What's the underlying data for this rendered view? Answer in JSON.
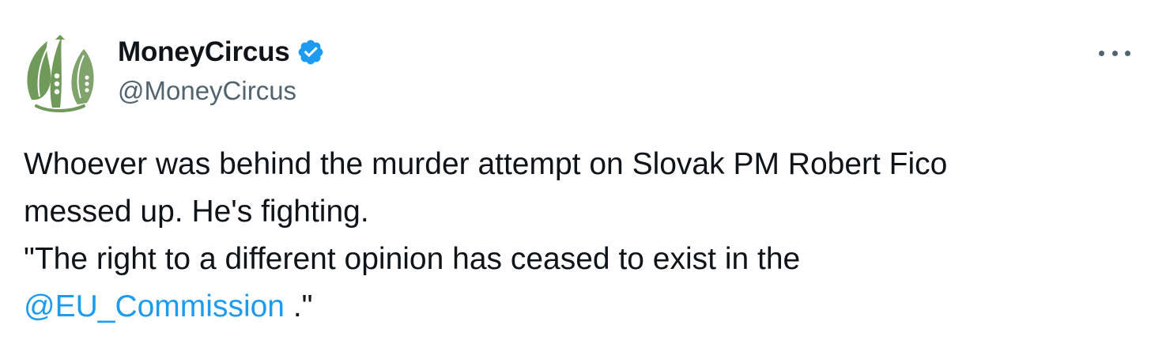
{
  "author": {
    "display_name": "MoneyCircus",
    "handle": "@MoneyCircus",
    "avatar_icon": "money-circus-logo-icon",
    "verified_icon": "verified-badge-icon",
    "verified_color": "#1d9bf0"
  },
  "menu": {
    "more_icon": "more-options-icon"
  },
  "tweet": {
    "line1": "Whoever was behind the murder attempt on Slovak PM Robert Fico",
    "line2": "messed up. He's fighting.",
    "line3": "\"The right to a different opinion has ceased to exist in the",
    "mention": "@EU_Commission",
    "line4_suffix": " .\""
  },
  "colors": {
    "text": "#0f1419",
    "secondary": "#536471",
    "link": "#1d9bf0",
    "avatar_green": "#6f9a5a"
  }
}
